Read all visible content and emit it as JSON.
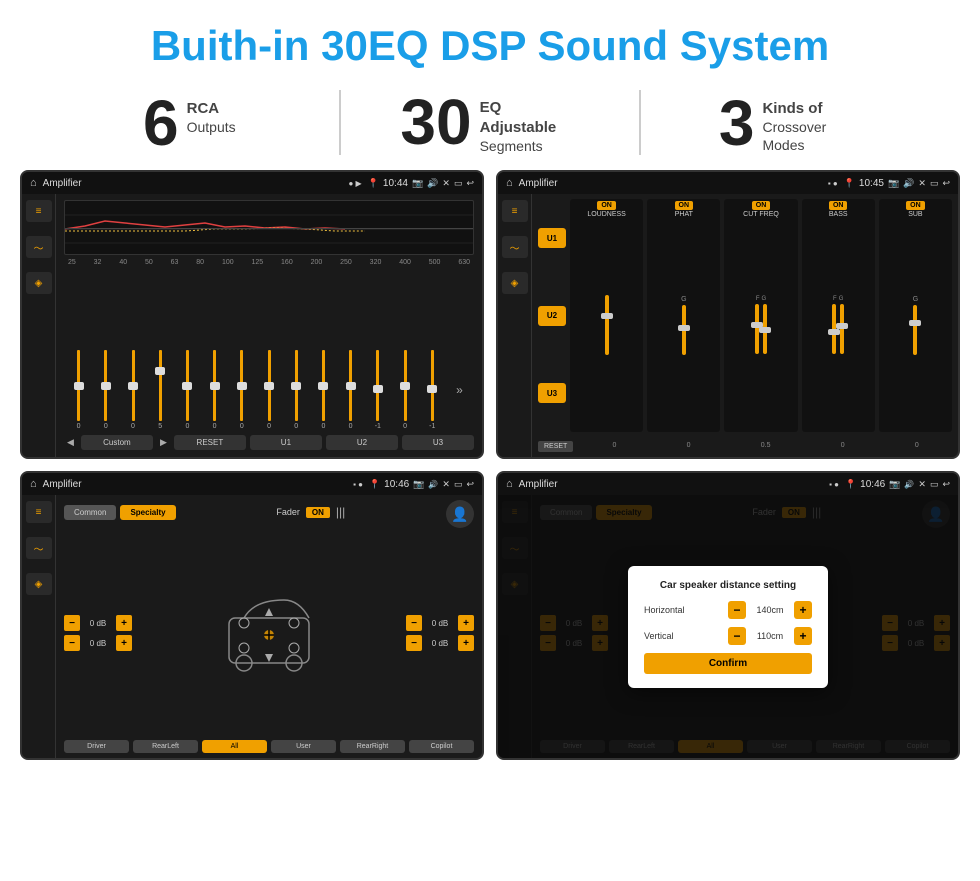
{
  "page": {
    "title": "Buith-in 30EQ DSP Sound System"
  },
  "stats": [
    {
      "number": "6",
      "label_bold": "RCA",
      "label": "Outputs"
    },
    {
      "number": "30",
      "label_bold": "EQ Adjustable",
      "label": "Segments"
    },
    {
      "number": "3",
      "label_bold": "Kinds of",
      "label": "Crossover Modes"
    }
  ],
  "screen1": {
    "app": "Amplifier",
    "time": "10:44",
    "freq_labels": [
      "25",
      "32",
      "40",
      "50",
      "63",
      "80",
      "100",
      "125",
      "160",
      "200",
      "250",
      "320",
      "400",
      "500",
      "630"
    ],
    "slider_values": [
      "0",
      "0",
      "0",
      "5",
      "0",
      "0",
      "0",
      "0",
      "0",
      "0",
      "0",
      "-1",
      "0",
      "-1"
    ],
    "nav_items": [
      "Custom",
      "RESET",
      "U1",
      "U2",
      "U3"
    ]
  },
  "screen2": {
    "app": "Amplifier",
    "time": "10:45",
    "panels": [
      "LOUDNESS",
      "PHAT",
      "CUT FREQ",
      "BASS",
      "SUB"
    ],
    "u_buttons": [
      "U1",
      "U2",
      "U3"
    ]
  },
  "screen3": {
    "app": "Amplifier",
    "time": "10:46",
    "tabs": [
      "Common",
      "Specialty"
    ],
    "fader_label": "Fader",
    "on_label": "ON",
    "db_values": [
      "0 dB",
      "0 dB",
      "0 dB",
      "0 dB"
    ],
    "bottom_btns": [
      "Driver",
      "RearLeft",
      "All",
      "User",
      "RearRight",
      "Copilot"
    ]
  },
  "screen4": {
    "app": "Amplifier",
    "time": "10:46",
    "dialog": {
      "title": "Car speaker distance setting",
      "horizontal_label": "Horizontal",
      "horizontal_value": "140cm",
      "vertical_label": "Vertical",
      "vertical_value": "110cm",
      "confirm_label": "Confirm"
    }
  },
  "icons": {
    "home": "⌂",
    "location": "📍",
    "camera": "📷",
    "volume": "🔊",
    "close": "✕",
    "back": "↩",
    "eq": "≡",
    "wave": "〜",
    "speaker": "◈",
    "user": "👤",
    "minus": "−",
    "plus": "+"
  }
}
